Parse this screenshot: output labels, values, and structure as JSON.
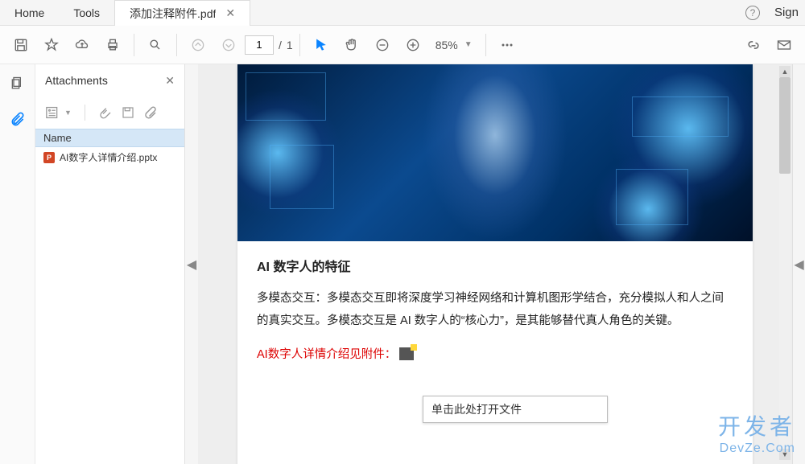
{
  "topbar": {
    "home": "Home",
    "tools": "Tools",
    "doc_tab": "添加注释附件.pdf",
    "sign": "Sign"
  },
  "toolbar": {
    "page_current": "1",
    "page_sep": "/",
    "page_total": "1",
    "zoom": "85%"
  },
  "panel": {
    "title": "Attachments",
    "col_name": "Name",
    "items": [
      {
        "label": "AI数字人详情介绍.pptx",
        "type": "pptx"
      }
    ]
  },
  "doc": {
    "heading": "AI 数字人的特征",
    "paragraph": "多模态交互：多模态交互即将深度学习神经网络和计算机图形学结合，充分模拟人和人之间的真实交互。多模态交互是 AI 数字人的“核心力”，是其能够替代真人角色的关键。",
    "attach_line": "AI数字人详情介绍见附件：",
    "tooltip": "单击此处打开文件"
  },
  "watermark": {
    "line1": "开发者",
    "line2": "DevZe.Com"
  }
}
